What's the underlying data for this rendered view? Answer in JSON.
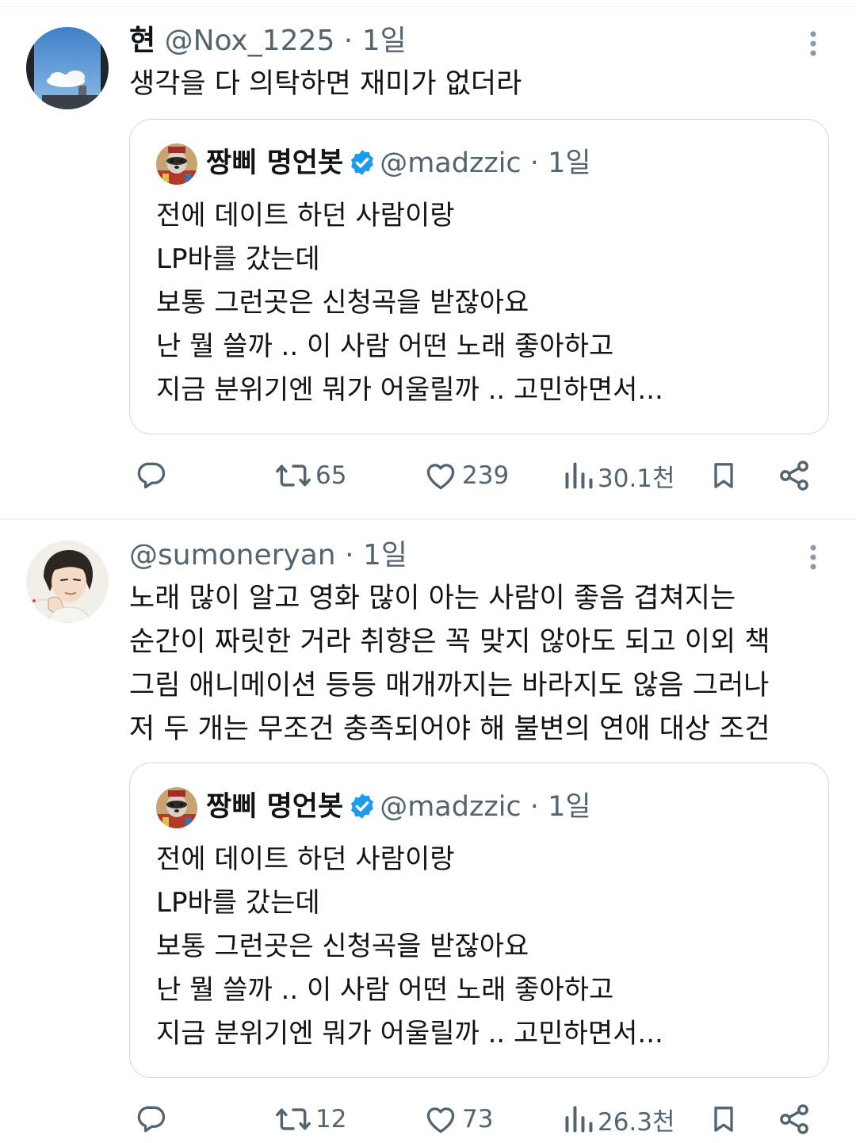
{
  "tweets": [
    {
      "display_name": "현",
      "handle": "@Nox_1225",
      "time": "1일",
      "text": "생각을 다 의탁하면 재미가 없더라",
      "quote": {
        "display_name": "짱삐 명언봇",
        "handle": "@madzzic",
        "time": "1일",
        "text": "전에 데이트 하던 사람이랑\nLP바를 갔는데\n보통 그런곳은 신청곡을 받잖아요\n난 뭘 쓸까 .. 이 사람 어떤 노래 좋아하고\n지금 분위기엔 뭐가 어울릴까 .. 고민하면서..."
      },
      "stats": {
        "retweets": "65",
        "likes": "239",
        "views": "30.1천"
      }
    },
    {
      "display_name": "",
      "handle": "@sumoneryan",
      "time": "1일",
      "text": "노래 많이 알고 영화 많이 아는 사람이 좋음 겹쳐지는\n순간이 짜릿한 거라 취향은 꼭 맞지 않아도 되고 이외 책\n그림 애니메이션 등등 매개까지는 바라지도 않음 그러나\n저 두 개는 무조건 충족되어야 해 불변의 연애 대상 조건",
      "quote": {
        "display_name": "짱삐 명언봇",
        "handle": "@madzzic",
        "time": "1일",
        "text": "전에 데이트 하던 사람이랑\nLP바를 갔는데\n보통 그런곳은 신청곡을 받잖아요\n난 뭘 쓸까 .. 이 사람 어떤 노래 좋아하고\n지금 분위기엔 뭐가 어울릴까 .. 고민하면서..."
      },
      "stats": {
        "retweets": "12",
        "likes": "73",
        "views": "26.3천"
      }
    }
  ],
  "separator": " · ",
  "icons": {
    "more": "more-vertical-icon",
    "verified": "verified-badge-icon",
    "reply": "reply-icon",
    "retweet": "retweet-icon",
    "like": "heart-icon",
    "views": "views-icon",
    "bookmark": "bookmark-icon",
    "share": "share-icon"
  },
  "colors": {
    "text": "#0f1419",
    "secondary": "#536471",
    "border": "#cfd9de",
    "verified": "#1d9bf0"
  }
}
